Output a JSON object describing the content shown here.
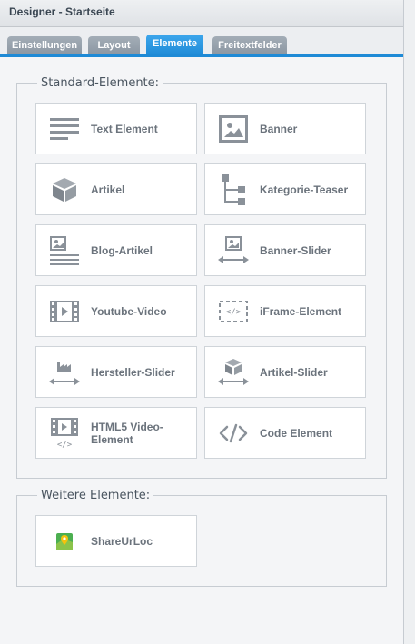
{
  "window": {
    "title": "Designer - Startseite"
  },
  "tabs": [
    {
      "label": "Einstellungen",
      "active": false
    },
    {
      "label": "Layout",
      "active": false
    },
    {
      "label": "Elemente",
      "active": true
    },
    {
      "label": "Freitextfelder",
      "active": false
    }
  ],
  "standard": {
    "legend": "Standard-Elemente:",
    "items": [
      {
        "label": "Text Element",
        "icon": "text-lines-icon"
      },
      {
        "label": "Banner",
        "icon": "image-icon"
      },
      {
        "label": "Artikel",
        "icon": "box-icon"
      },
      {
        "label": "Kategorie-Teaser",
        "icon": "tree-icon"
      },
      {
        "label": "Blog-Artikel",
        "icon": "blog-article-icon"
      },
      {
        "label": "Banner-Slider",
        "icon": "image-slider-icon"
      },
      {
        "label": "Youtube-Video",
        "icon": "film-icon"
      },
      {
        "label": "iFrame-Element",
        "icon": "iframe-icon"
      },
      {
        "label": "Hersteller-Slider",
        "icon": "factory-slider-icon"
      },
      {
        "label": "Artikel-Slider",
        "icon": "box-slider-icon"
      },
      {
        "label": "HTML5 Video-Element",
        "icon": "html5-video-icon"
      },
      {
        "label": "Code Element",
        "icon": "code-icon"
      }
    ]
  },
  "further": {
    "legend": "Weitere Elemente:",
    "items": [
      {
        "label": "ShareUrLoc",
        "icon": "map-pin-icon"
      }
    ]
  },
  "colors": {
    "accent": "#1e8ad6",
    "tab_inactive": "#97a2ad",
    "icon": "#8a9199",
    "label": "#6b737c"
  }
}
